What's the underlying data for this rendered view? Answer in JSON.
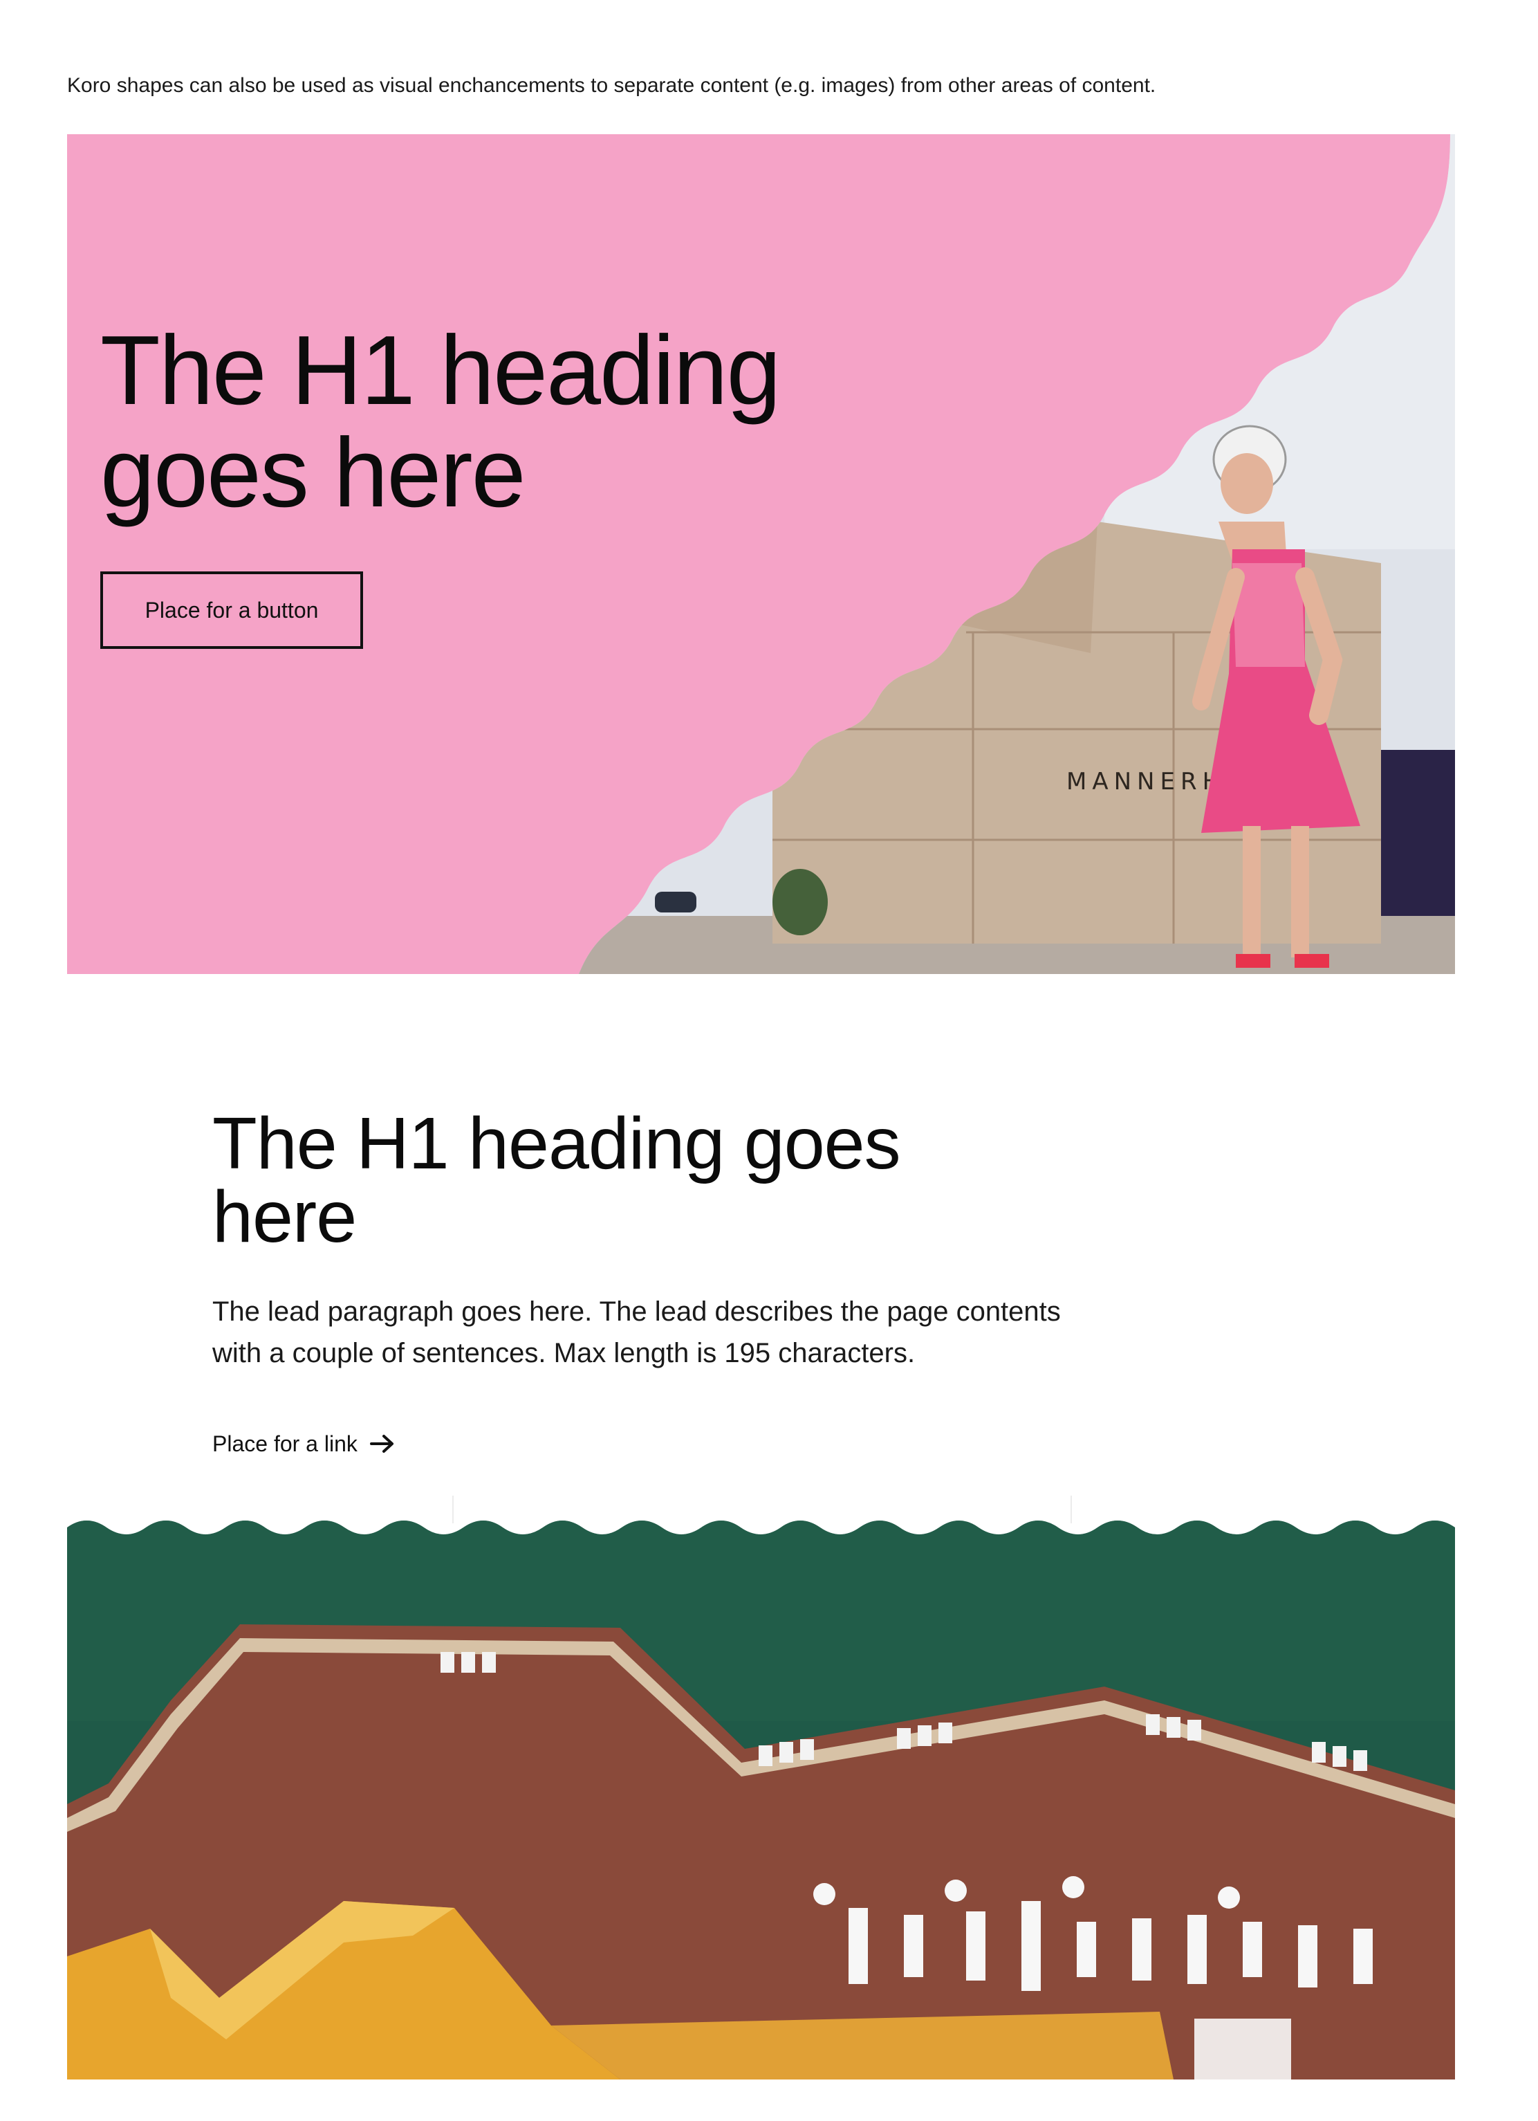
{
  "intro": {
    "text": "Koro shapes can also be used as visual enchancements to separate content (e.g. images) from other areas of content."
  },
  "hero": {
    "title_line1": "The H1 heading",
    "title_line2": "goes here",
    "button_label": "Place for a button",
    "monument_inscription": "MANNERHEI",
    "background_color": "#f5a3c7"
  },
  "section": {
    "title_line1": "The H1 heading goes",
    "title_line2": "here",
    "lead": "The lead paragraph goes here. The lead describes the page contents with a couple of sentences. Max length is 195 characters.",
    "link_label": "Place for a link",
    "link_icon": "arrow-right-icon"
  },
  "colors": {
    "koro_pink": "#f5a3c7",
    "text": "#111111",
    "water": "#1f5a48",
    "deck": "#8a4a3a",
    "roof": "#e7a52d"
  }
}
